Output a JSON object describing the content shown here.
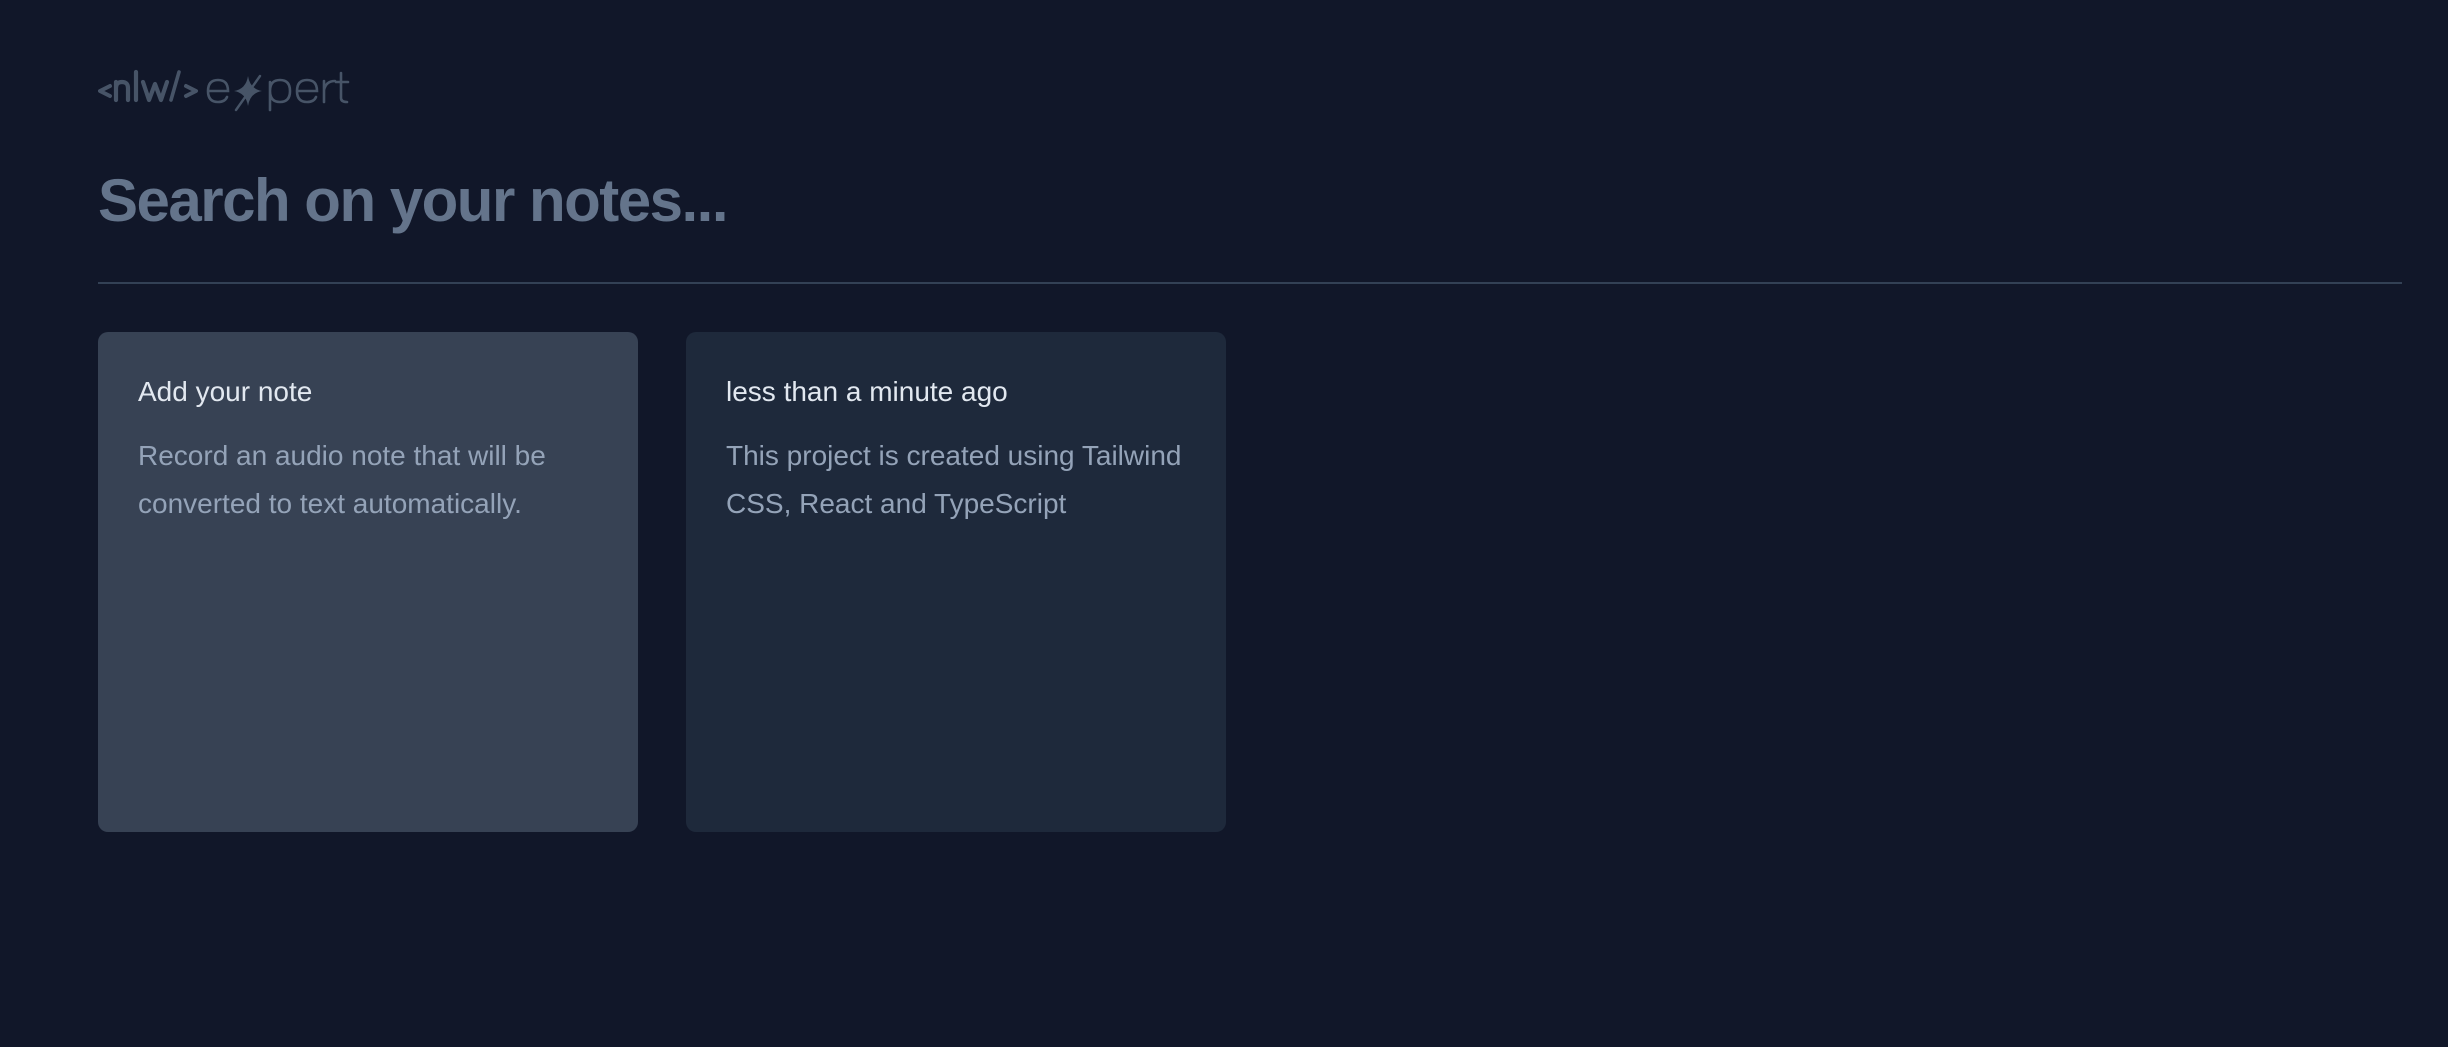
{
  "logo": {
    "brand": "<nlw/>",
    "product": "expert",
    "alt": "nlw expert"
  },
  "search": {
    "placeholder": "Search on your notes...",
    "value": ""
  },
  "cards": [
    {
      "type": "add",
      "title": "Add your note",
      "body": "Record an audio note that will be converted to text automatically."
    },
    {
      "type": "note",
      "title": "less than a minute ago",
      "body": "This project is created using Tailwind CSS, React and TypeScript"
    }
  ],
  "colors": {
    "background": "#111729",
    "card_add": "#374254",
    "card_note": "#1e293b",
    "divider": "#334155",
    "placeholder": "#64748b",
    "title_text": "#e2e8f0",
    "body_text": "#94a3b8",
    "logo": "#475467"
  }
}
